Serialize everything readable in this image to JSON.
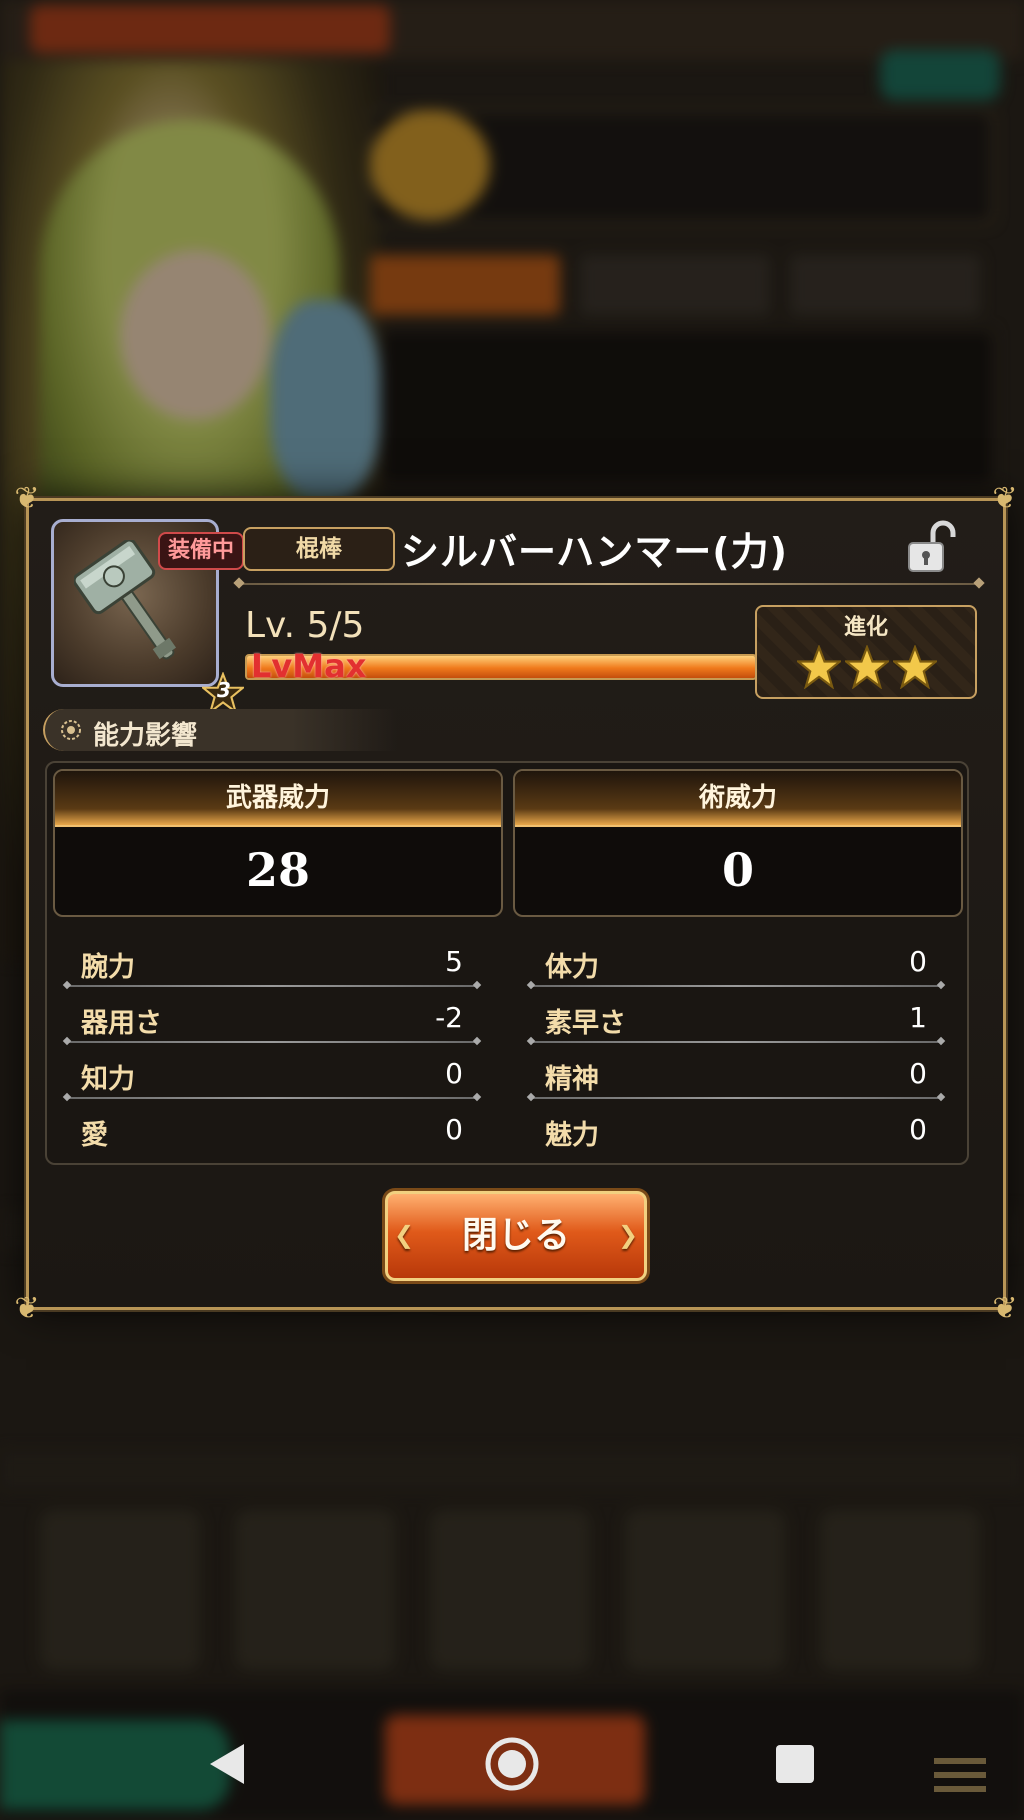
{
  "modal": {
    "equip_badge": "装備中",
    "rarity": "3",
    "weapon_type": "棍棒",
    "weapon_name": "シルバーハンマー(力)",
    "level_text": "Lv. 5/5",
    "exp_label": "LvMax",
    "exp_fill_percent": 100,
    "evolution_label": "進化",
    "evolution_stars": 3,
    "section_title": "能力影響",
    "powers": [
      {
        "label": "武器威力",
        "value": "28"
      },
      {
        "label": "術威力",
        "value": "0"
      }
    ],
    "stats": [
      {
        "left_label": "腕力",
        "left_value": "5",
        "right_label": "体力",
        "right_value": "0"
      },
      {
        "left_label": "器用さ",
        "left_value": "-2",
        "right_label": "素早さ",
        "right_value": "1"
      },
      {
        "left_label": "知力",
        "left_value": "0",
        "right_label": "精神",
        "right_value": "0"
      },
      {
        "left_label": "愛",
        "left_value": "0",
        "right_label": "魅力",
        "right_value": "0"
      }
    ],
    "close_label": "閉じる"
  },
  "colors": {
    "accent_gold": "#c7a061",
    "button_orange": "#e05a1a",
    "equip_red": "#d04a4a"
  },
  "icons": {
    "lock": "unlock-padlock-icon",
    "weapon": "silver-hammer-icon",
    "star": "star-icon"
  }
}
